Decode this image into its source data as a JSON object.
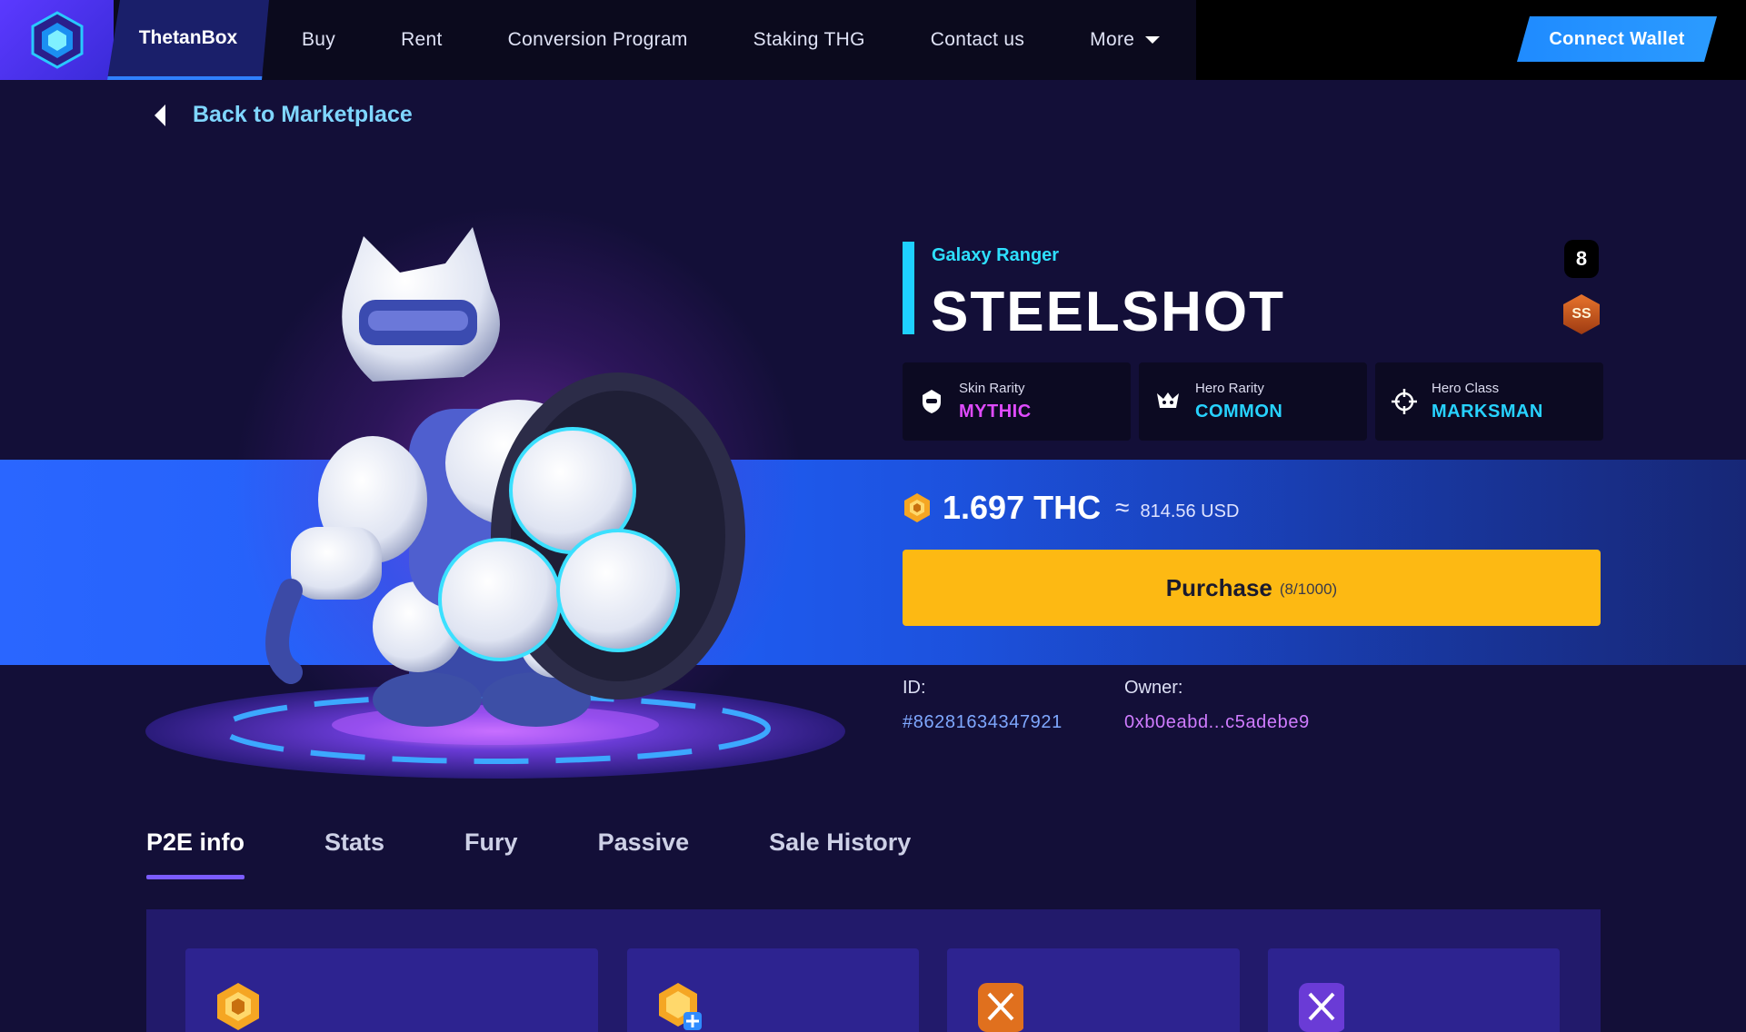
{
  "nav": {
    "brand": "ThetanBox",
    "items": [
      "Buy",
      "Rent",
      "Conversion Program",
      "Staking THG",
      "Contact us"
    ],
    "more": "More",
    "connect": "Connect Wallet"
  },
  "back": "Back to Marketplace",
  "hero": {
    "subtitle": "Galaxy Ranger",
    "name": "STEELSHOT",
    "level": "8",
    "rank": "SS"
  },
  "attributes": [
    {
      "label": "Skin Rarity",
      "value": "MYTHIC",
      "color": "#e04bff",
      "icon": "skin-rarity-icon"
    },
    {
      "label": "Hero Rarity",
      "value": "COMMON",
      "color": "#27d2ff",
      "icon": "hero-rarity-icon"
    },
    {
      "label": "Hero Class",
      "value": "MARKSMAN",
      "color": "#27d2ff",
      "icon": "crosshair-icon"
    }
  ],
  "price": {
    "amount": "1.697 THC",
    "approx": "≈",
    "usd": "814.56 USD"
  },
  "purchase": {
    "label": "Purchase",
    "count": "(8/1000)"
  },
  "meta": {
    "id_label": "ID:",
    "id_value": "#86281634347921",
    "owner_label": "Owner:",
    "owner_value": "0xb0eabd...c5adebe9"
  },
  "tabs": [
    "P2E info",
    "Stats",
    "Fury",
    "Passive",
    "Sale History"
  ],
  "colors": {
    "accent": "#1ed0ff",
    "purchase": "#fdb913",
    "owner": "#d07cff",
    "id": "#7fa8ff"
  }
}
